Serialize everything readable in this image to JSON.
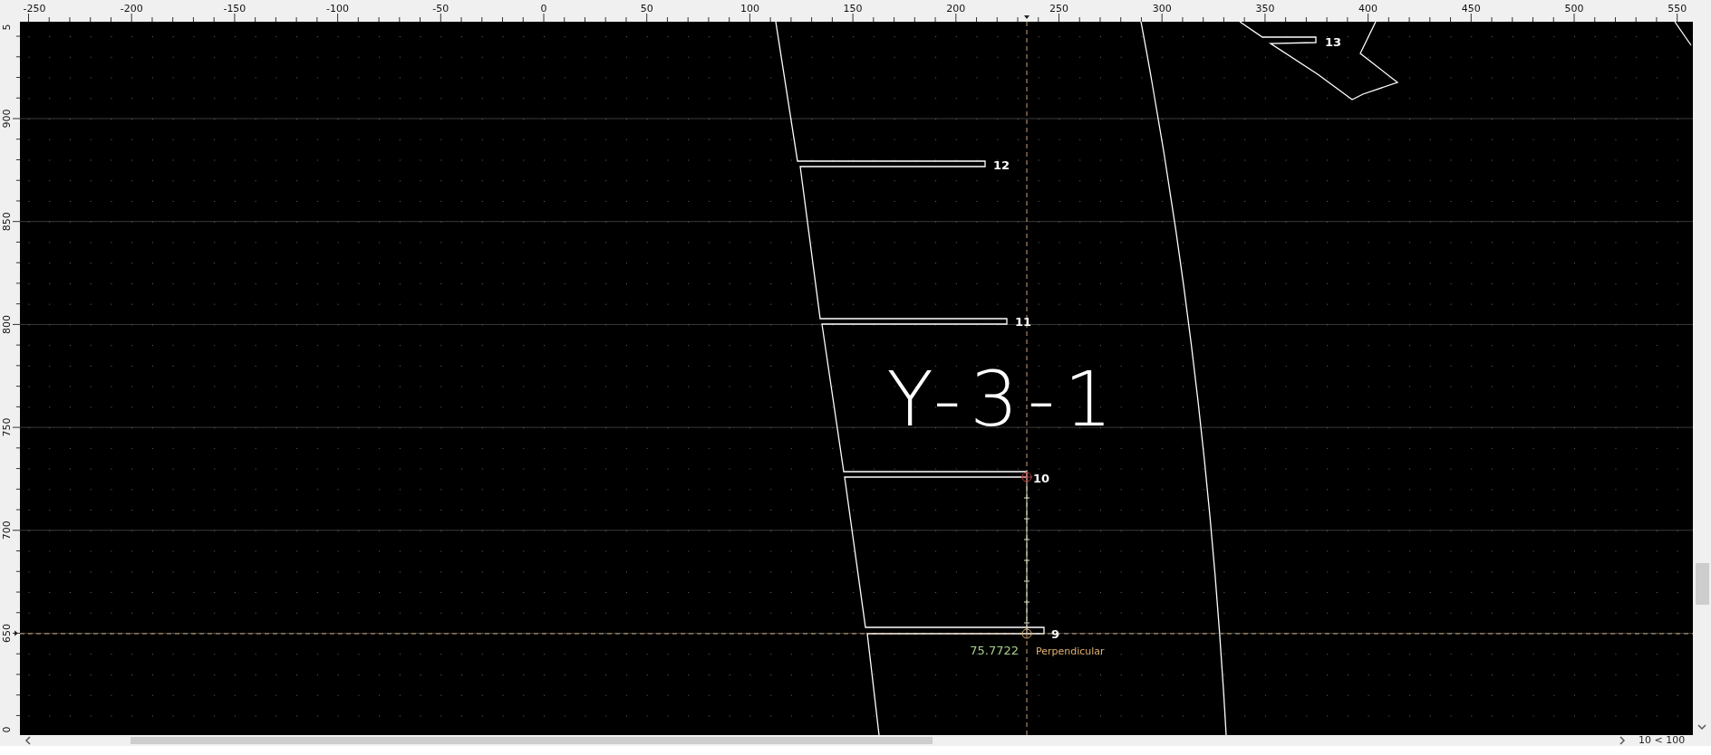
{
  "rulers": {
    "x_labels": [
      "-250",
      "-200",
      "-150",
      "-100",
      "-50",
      "0",
      "50",
      "100",
      "150",
      "200",
      "250",
      "300",
      "350",
      "400",
      "450",
      "500",
      "550"
    ],
    "y_labels": [
      "5",
      "900",
      "850",
      "800",
      "750",
      "700",
      "650",
      "0"
    ]
  },
  "canvas": {
    "point_labels": [
      "13",
      "12",
      "11",
      "10",
      "9"
    ],
    "block_label": "Y-3-1",
    "measurement": {
      "value": "75.7722",
      "snap": "Perpendicular"
    }
  },
  "status_bar": {
    "zoom": "10 < 100"
  }
}
